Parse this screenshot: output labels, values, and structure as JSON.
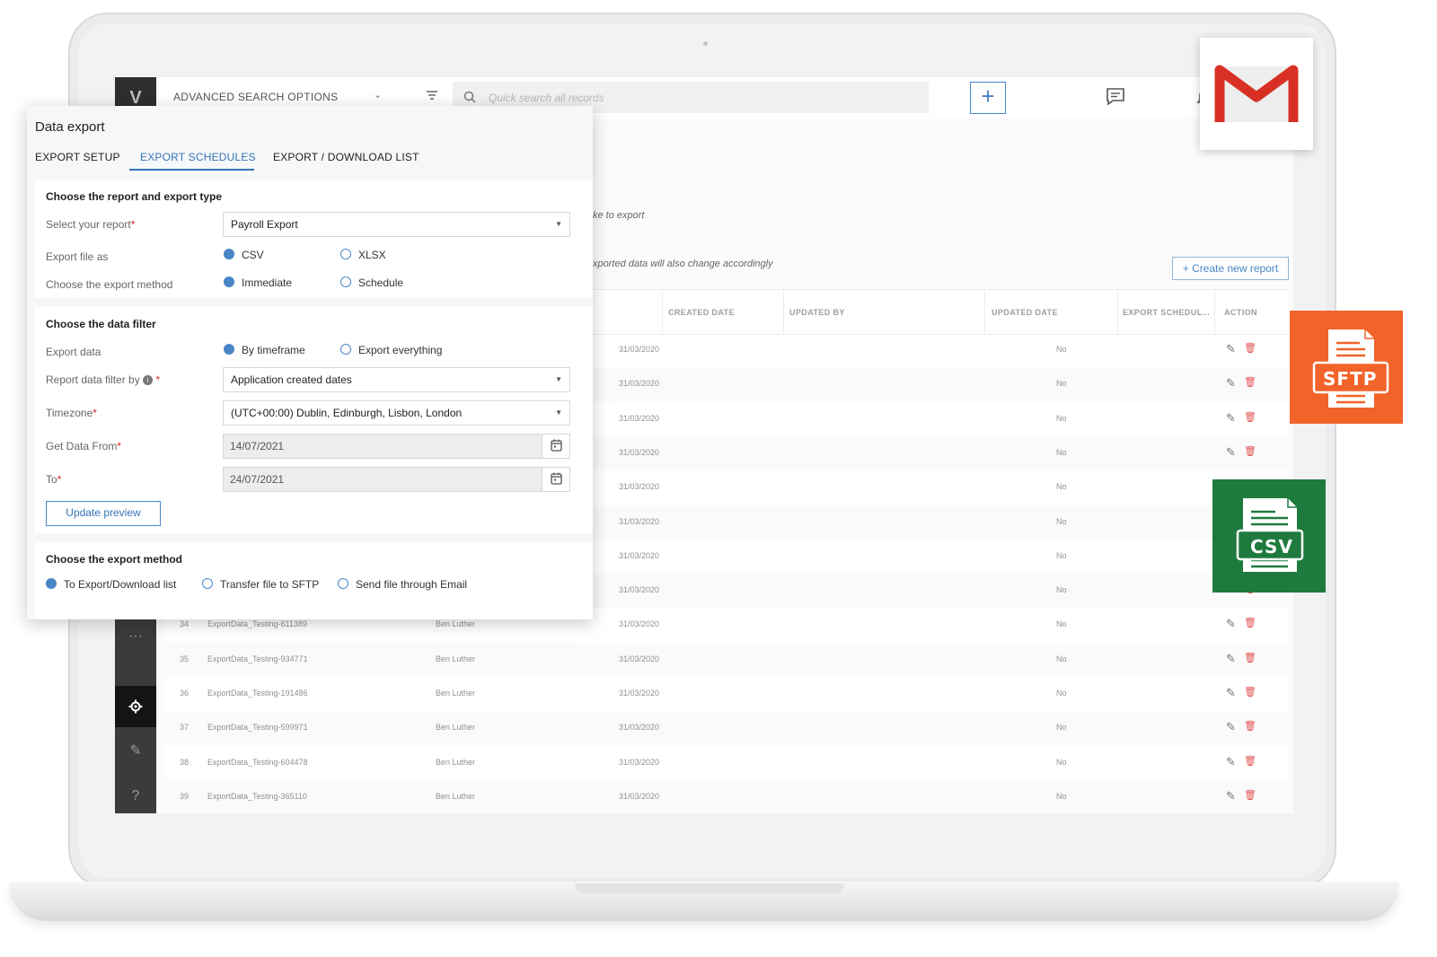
{
  "topbar": {
    "advanced_search": "ADVANCED SEARCH OPTIONS",
    "search_placeholder": "Quick search all records"
  },
  "background_page": {
    "hint_top": "ke to export",
    "hint_bottom": "xported data will also change accordingly",
    "create_button": "+ Create new report",
    "columns": [
      "CREATED DATE",
      "UPDATED BY",
      "UPDATED DATE",
      "EXPORT SCHEDUL...",
      "ACTION"
    ],
    "rows": [
      {
        "id": "",
        "name": "",
        "owner": "",
        "date": "31/03/2020",
        "scheduled": "No"
      },
      {
        "id": "",
        "name": "",
        "owner": "",
        "date": "31/03/2020",
        "scheduled": "No"
      },
      {
        "id": "",
        "name": "",
        "owner": "",
        "date": "31/03/2020",
        "scheduled": "No"
      },
      {
        "id": "",
        "name": "",
        "owner": "",
        "date": "31/03/2020",
        "scheduled": "No"
      },
      {
        "id": "",
        "name": "",
        "owner": "",
        "date": "31/03/2020",
        "scheduled": "No"
      },
      {
        "id": "",
        "name": "",
        "owner": "",
        "date": "31/03/2020",
        "scheduled": "No"
      },
      {
        "id": "",
        "name": "",
        "owner": "",
        "date": "31/03/2020",
        "scheduled": "No"
      },
      {
        "id": "",
        "name": "",
        "owner": "",
        "date": "31/03/2020",
        "scheduled": "No"
      },
      {
        "id": "34",
        "name": "ExportData_Testing-611389",
        "owner": "Ben Luther",
        "date": "31/03/2020",
        "scheduled": "No"
      },
      {
        "id": "35",
        "name": "ExportData_Testing-934771",
        "owner": "Ben Luther",
        "date": "31/03/2020",
        "scheduled": "No"
      },
      {
        "id": "36",
        "name": "ExportData_Testing-191486",
        "owner": "Ben Luther",
        "date": "31/03/2020",
        "scheduled": "No"
      },
      {
        "id": "37",
        "name": "ExportData_Testing-599971",
        "owner": "Ben Luther",
        "date": "31/03/2020",
        "scheduled": "No"
      },
      {
        "id": "38",
        "name": "ExportData_Testing-604478",
        "owner": "Ben Luther",
        "date": "31/03/2020",
        "scheduled": "No"
      },
      {
        "id": "39",
        "name": "ExportData_Testing-365110",
        "owner": "Ben Luther",
        "date": "31/03/2020",
        "scheduled": "No"
      }
    ]
  },
  "dialog": {
    "title": "Data export",
    "tabs": [
      "EXPORT SETUP",
      "EXPORT SCHEDULES",
      "EXPORT / DOWNLOAD LIST"
    ],
    "active_tab": "EXPORT SCHEDULES",
    "section_report": {
      "title": "Choose the report and export type",
      "select_report_label": "Select your report",
      "select_report_value": "Payroll Export",
      "export_as_label": "Export file as",
      "format_options": [
        "CSV",
        "XLSX"
      ],
      "format_selected": "CSV",
      "method_label": "Choose the export method",
      "method_options": [
        "Immediate",
        "Schedule"
      ],
      "method_selected": "Immediate"
    },
    "section_filter": {
      "title": "Choose the data filter",
      "export_data_label": "Export data",
      "export_data_options": [
        "By timeframe",
        "Export everything"
      ],
      "export_data_selected": "By timeframe",
      "filter_by_label": "Report data filter by",
      "filter_by_value": "Application created dates",
      "timezone_label": "Timezone",
      "timezone_value": "(UTC+00:00) Dublin, Edinburgh, Lisbon, London",
      "from_label": "Get Data From",
      "from_value": "14/07/2021",
      "to_label": "To",
      "to_value": "24/07/2021",
      "update_button": "Update preview"
    },
    "section_method": {
      "title": "Choose the export method",
      "options": [
        "To Export/Download list",
        "Transfer file to SFTP",
        "Send file through Email"
      ],
      "selected": "To Export/Download list"
    }
  },
  "badges": {
    "sftp_label": "SFTP",
    "csv_label": "CSV",
    "sftp_color": "#f2632a",
    "csv_color": "#1f7a3e",
    "gmail_red": "#d93025"
  },
  "colors": {
    "accent": "#3475b8",
    "required": "#d0262d"
  }
}
